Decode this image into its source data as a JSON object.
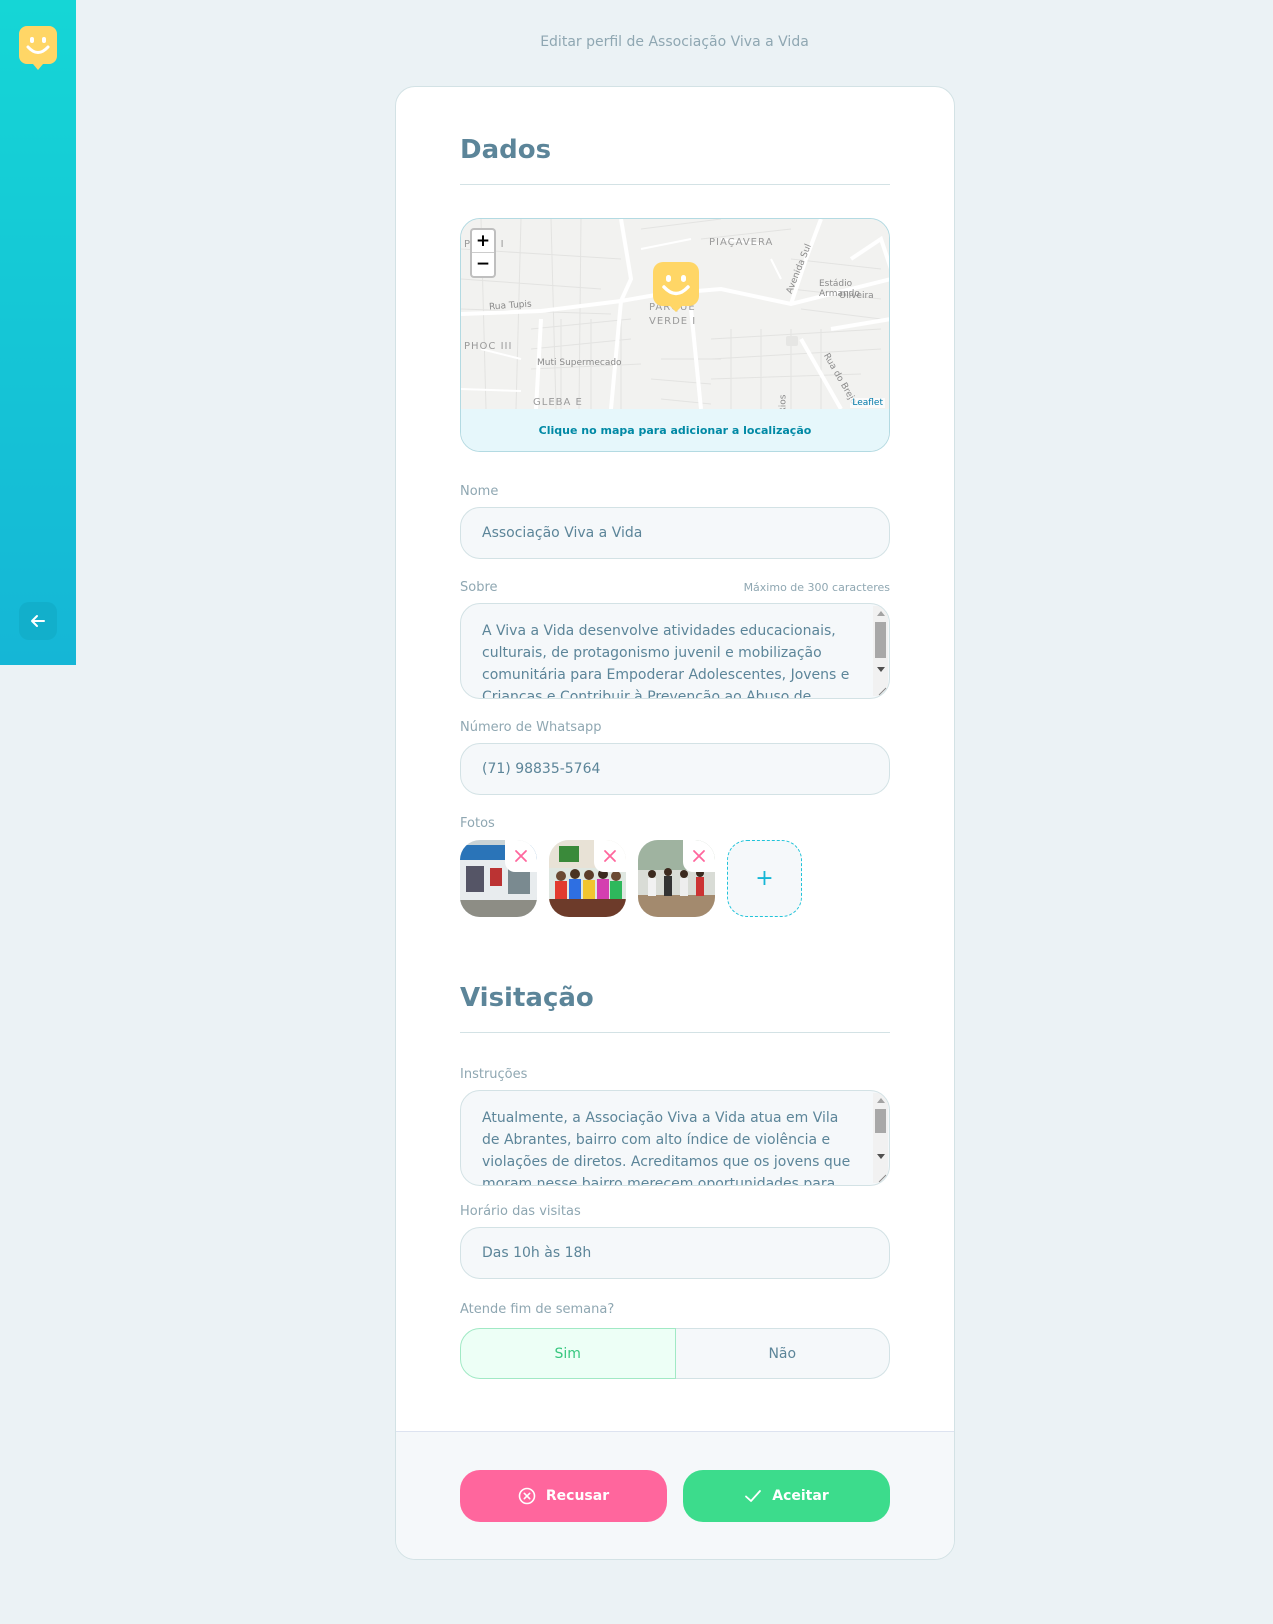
{
  "page": {
    "title": "Editar perfil de Associação Viva a Vida"
  },
  "sections": {
    "data_title": "Dados",
    "visit_title": "Visitação"
  },
  "map": {
    "zoom_in": "+",
    "zoom_out": "−",
    "footer": "Clique no mapa para adicionar a localização",
    "attribution": "Leaflet",
    "labels": {
      "piacavera": "PIAÇAVERA",
      "parque": "PARQUE",
      "verde": "VERDE I",
      "phoc": "PHOC III",
      "phoc_top": "PHOC I",
      "gleba": "GLEBA E",
      "rua_tupis": "Rua Tupis",
      "muti": "Muti Supermecado",
      "estadio_1": "Estádio Armando",
      "estadio_2": "Oliveira",
      "avenida_sul": "Avenida Sul",
      "rua_brejo": "Rua do Brejo",
      "rios": "Rios"
    }
  },
  "fields": {
    "name": {
      "label": "Nome",
      "value": "Associação Viva a Vida"
    },
    "about": {
      "label": "Sobre",
      "hint": "Máximo de 300 caracteres",
      "value": "A Viva a Vida desenvolve atividades educacionais, culturais, de protagonismo juvenil e mobilização comunitária para Empoderar Adolescentes, Jovens e Crianças e Contribuir à Prevenção ao Abuso de Drogas."
    },
    "whatsapp": {
      "label": "Número de Whatsapp",
      "value": "(71) 98835-5764"
    },
    "photos": {
      "label": "Fotos",
      "add": "+"
    },
    "instructions": {
      "label": "Instruções",
      "value": "Atualmente, a Associação Viva a Vida atua em Vila de Abrantes, bairro com alto índice de violência e violações de diretos.  Acreditamos que os jovens que moram nesse bairro merecem oportunidades para aumentar sua"
    },
    "hours": {
      "label": "Horário das visitas",
      "value": "Das 10h às 18h"
    },
    "weekends": {
      "label": "Atende fim de semana?",
      "yes": "Sim",
      "no": "Não",
      "selected": "Sim"
    }
  },
  "actions": {
    "reject": "Recusar",
    "accept": "Aceitar"
  },
  "colors": {
    "primary": "#15c3d6",
    "reject": "#ff669d",
    "accept": "#3cdc8c",
    "text": "#5c8599",
    "marker": "#ffd666"
  }
}
